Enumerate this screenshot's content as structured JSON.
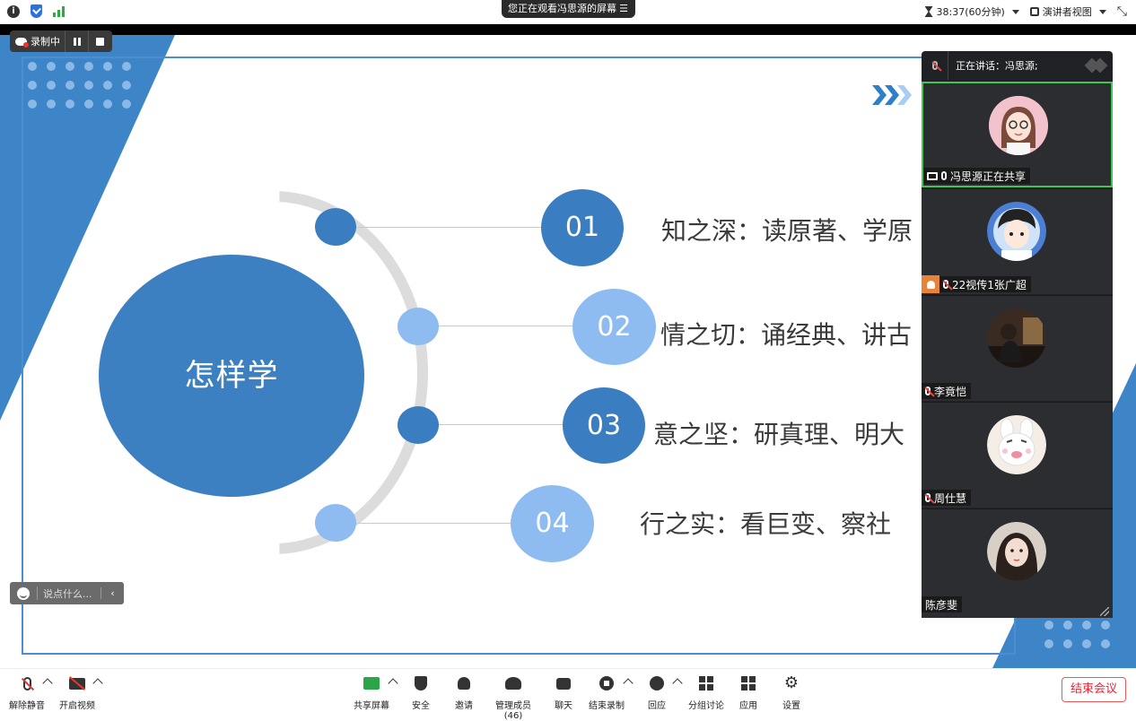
{
  "top_bar": {
    "share_banner": "您正在观看冯思源的屏幕",
    "timer": "38:37(60分钟)",
    "view_mode": "演讲者视图"
  },
  "recording": {
    "label": "录制中"
  },
  "slide": {
    "center_label": "怎样学",
    "items": [
      {
        "number": "01",
        "text": "知之深：读原著、学原"
      },
      {
        "number": "02",
        "text": "情之切：诵经典、讲古"
      },
      {
        "number": "03",
        "text": "意之坚：研真理、明大"
      },
      {
        "number": "04",
        "text": "行之实：看巨变、察社"
      }
    ]
  },
  "chat": {
    "placeholder": "说点什么..."
  },
  "panel": {
    "speaking": "正在讲话：冯思源;",
    "participants": [
      {
        "name": "冯思源正在共享",
        "avatar": "girl-glasses-avatar"
      },
      {
        "name": "22视传1张广超",
        "avatar": "boy-cartoon-avatar"
      },
      {
        "name": "李竟恺",
        "avatar": "dark-photo-avatar"
      },
      {
        "name": "周仕慧",
        "avatar": "bunny-cartoon-avatar"
      },
      {
        "name": "陈彦斐",
        "avatar": "girl-photo-avatar"
      }
    ]
  },
  "toolbar": {
    "unmute": "解除静音",
    "start_video": "开启视频",
    "share_screen": "共享屏幕",
    "security": "安全",
    "invite": "邀请",
    "manage_members": "管理成员(46)",
    "chat": "聊天",
    "end_recording": "结束录制",
    "reactions": "回应",
    "breakout": "分组讨论",
    "apps": "应用",
    "settings": "设置",
    "end_meeting": "结束会议"
  },
  "colors": {
    "slide_blue": "#3d80c2",
    "slide_light_blue": "#8ebcf0",
    "active_speaker_border": "#3fc654",
    "end_meeting_red": "#e23"
  }
}
